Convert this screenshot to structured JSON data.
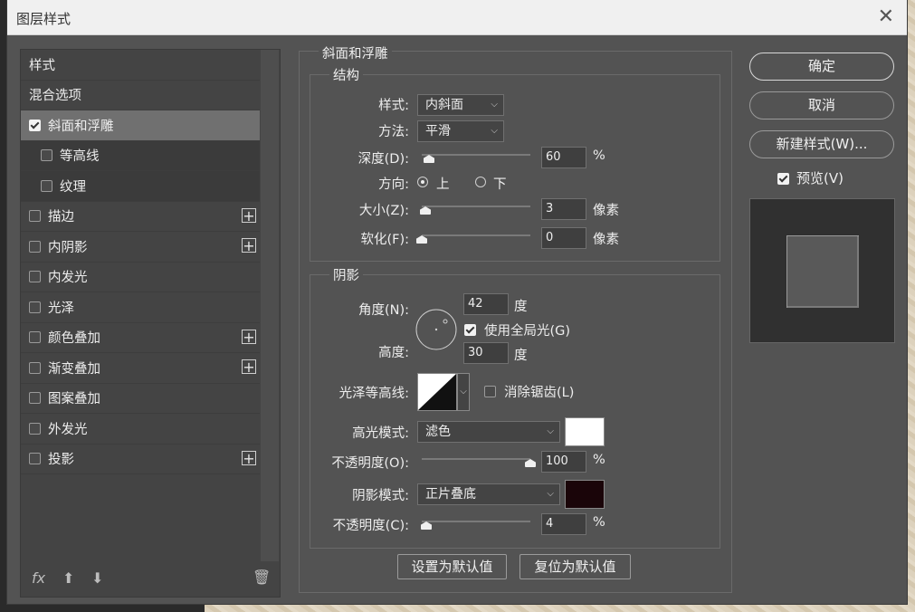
{
  "window": {
    "title": "图层样式"
  },
  "left": {
    "items": [
      {
        "label": "样式",
        "checkbox": false
      },
      {
        "label": "混合选项",
        "checkbox": false
      },
      {
        "label": "斜面和浮雕",
        "checkbox": true,
        "checked": true,
        "selected": true
      },
      {
        "label": "等高线",
        "checkbox": true,
        "checked": false,
        "sub": true
      },
      {
        "label": "纹理",
        "checkbox": true,
        "checked": false,
        "sub": true
      },
      {
        "label": "描边",
        "checkbox": true,
        "checked": false,
        "plus": true
      },
      {
        "label": "内阴影",
        "checkbox": true,
        "checked": false,
        "plus": true
      },
      {
        "label": "内发光",
        "checkbox": true,
        "checked": false
      },
      {
        "label": "光泽",
        "checkbox": true,
        "checked": false
      },
      {
        "label": "颜色叠加",
        "checkbox": true,
        "checked": false,
        "plus": true
      },
      {
        "label": "渐变叠加",
        "checkbox": true,
        "checked": false,
        "plus": true
      },
      {
        "label": "图案叠加",
        "checkbox": true,
        "checked": false
      },
      {
        "label": "外发光",
        "checkbox": true,
        "checked": false
      },
      {
        "label": "投影",
        "checkbox": true,
        "checked": false,
        "plus": true
      }
    ],
    "footer": {
      "fx": "fx",
      "up": "⬆",
      "down": "⬇",
      "trash": "🗑"
    }
  },
  "bevel": {
    "section_title": "斜面和浮雕",
    "structure": {
      "title": "结构",
      "style_label": "样式:",
      "style_value": "内斜面",
      "technique_label": "方法:",
      "technique_value": "平滑",
      "depth_label": "深度(D):",
      "depth_value": "60",
      "depth_unit": "%",
      "direction_label": "方向:",
      "dir_up": "上",
      "dir_down": "下",
      "size_label": "大小(Z):",
      "size_value": "3",
      "size_unit": "像素",
      "soften_label": "软化(F):",
      "soften_value": "0",
      "soften_unit": "像素"
    },
    "shading": {
      "title": "阴影",
      "angle_label": "角度(N):",
      "angle_value": "42",
      "angle_unit": "度",
      "global_light_label": "使用全局光(G)",
      "altitude_label": "高度:",
      "altitude_value": "30",
      "altitude_unit": "度",
      "gloss_label": "光泽等高线:",
      "antialias_label": "消除锯齿(L)",
      "highlight_label": "高光模式:",
      "highlight_value": "滤色",
      "highlight_color": "#ffffff",
      "hl_opacity_label": "不透明度(O):",
      "hl_opacity_value": "100",
      "hl_opacity_unit": "%",
      "shadow_label": "阴影模式:",
      "shadow_value": "正片叠底",
      "shadow_color": "#1a0509",
      "sh_opacity_label": "不透明度(C):",
      "sh_opacity_value": "4",
      "sh_opacity_unit": "%"
    },
    "make_default": "设置为默认值",
    "reset_default": "复位为默认值"
  },
  "right": {
    "ok": "确定",
    "cancel": "取消",
    "new_style": "新建样式(W)...",
    "preview_label": "预览(V)"
  }
}
